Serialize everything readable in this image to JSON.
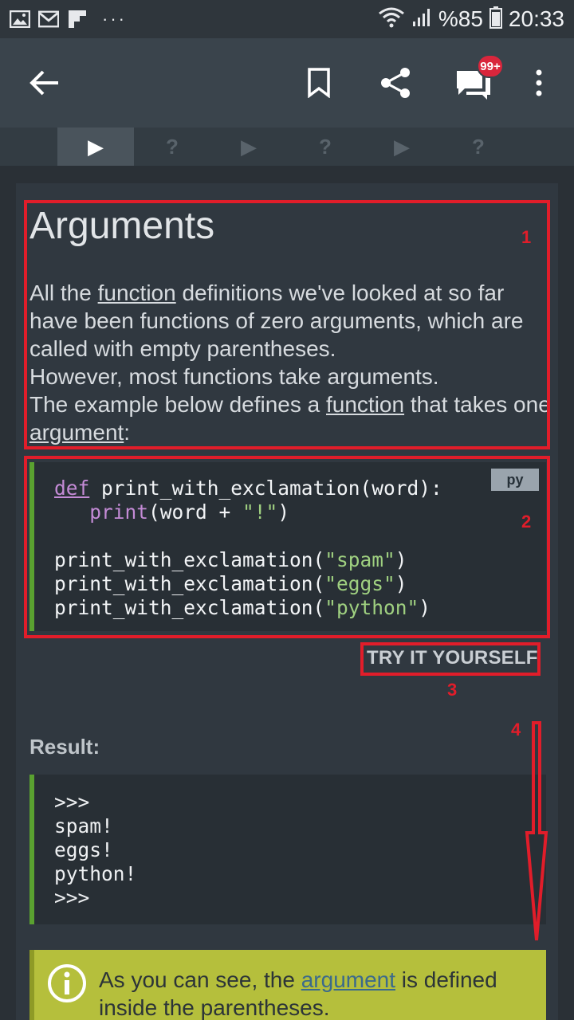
{
  "status_bar": {
    "battery": "%85",
    "time": "20:33",
    "overflow": "···"
  },
  "app_bar": {
    "badge": "99+",
    "icons": [
      "back-arrow-icon",
      "bookmark-icon",
      "share-icon",
      "comments-icon",
      "more-vert-icon"
    ]
  },
  "tabs": [
    {
      "symbol": "▶",
      "active": true
    },
    {
      "symbol": "?",
      "active": false
    },
    {
      "symbol": "▶",
      "active": false
    },
    {
      "symbol": "?",
      "active": false
    },
    {
      "symbol": "▶",
      "active": false
    },
    {
      "symbol": "?",
      "active": false
    }
  ],
  "lesson": {
    "title": "Arguments",
    "p1_a": "All the ",
    "p1_link": "function",
    "p1_b": " definitions we've looked at so far have been functions of zero arguments, which are called with empty parentheses.",
    "p2": "However, most functions take arguments.",
    "p3_a": "The example below defines a ",
    "p3_link": "function",
    "p3_b": " that takes one ",
    "p3_link2": "argument",
    "p3_c": ":"
  },
  "code": {
    "lang": "py",
    "l1_kw": "def",
    "l1_rest": " print_with_exclamation(word):",
    "l2_indent": "   ",
    "l2_fn": "print",
    "l2_a": "(word + ",
    "l2_str": "\"!\"",
    "l2_b": ")",
    "l4_a": "print_with_exclamation(",
    "l4_str": "\"spam\"",
    "l4_b": ")",
    "l5_a": "print_with_exclamation(",
    "l5_str": "\"eggs\"",
    "l5_b": ")",
    "l6_a": "print_with_exclamation(",
    "l6_str": "\"python\"",
    "l6_b": ")"
  },
  "try_button": "TRY IT YOURSELF",
  "result": {
    "label": "Result:",
    "lines": ">>>\nspam!\neggs!\npython!\n>>>"
  },
  "note": {
    "a": "As you can see, the ",
    "link": "argument",
    "b": " is defined inside the parentheses."
  },
  "annotations": {
    "n1": "1",
    "n2": "2",
    "n3": "3",
    "n4": "4"
  },
  "colors": {
    "annotation": "#e11d2a",
    "code_accent": "#5aa130",
    "note_bg": "#b5bf3c"
  }
}
